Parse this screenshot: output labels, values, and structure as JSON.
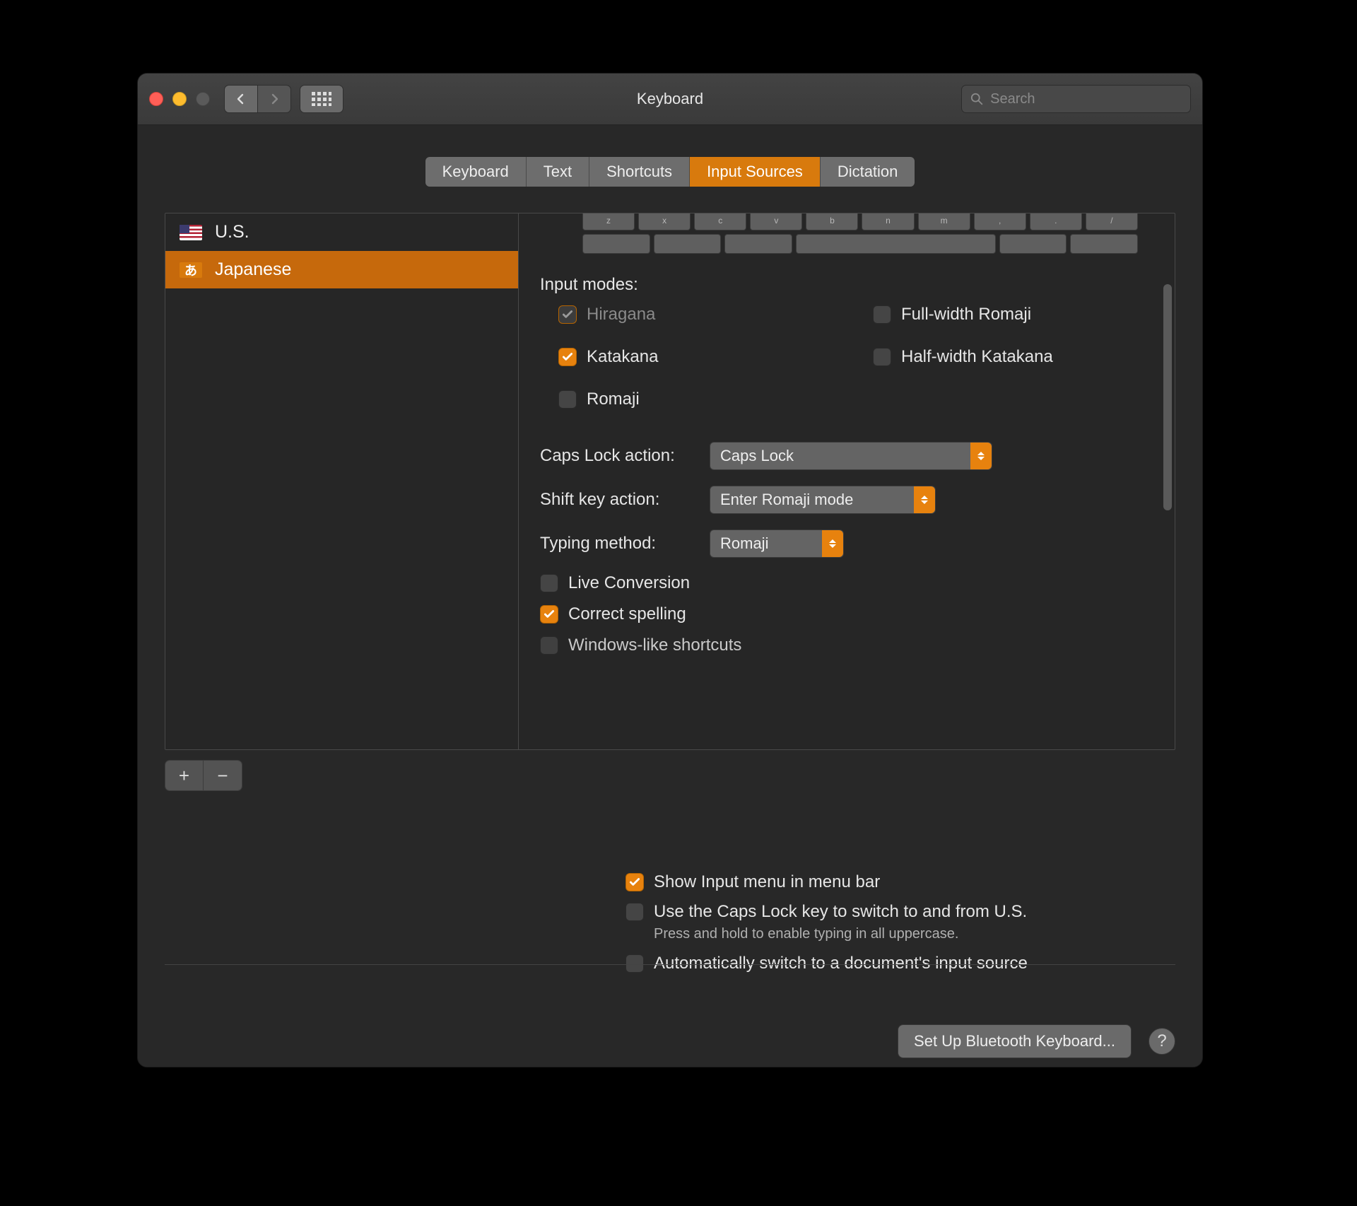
{
  "window": {
    "title": "Keyboard"
  },
  "search": {
    "placeholder": "Search"
  },
  "tabs": [
    {
      "label": "Keyboard",
      "active": false
    },
    {
      "label": "Text",
      "active": false
    },
    {
      "label": "Shortcuts",
      "active": false
    },
    {
      "label": "Input Sources",
      "active": true
    },
    {
      "label": "Dictation",
      "active": false
    }
  ],
  "sources": [
    {
      "name": "U.S.",
      "flag": "us",
      "selected": false
    },
    {
      "name": "Japanese",
      "flag": "jp",
      "glyph": "あ",
      "selected": true
    }
  ],
  "detail": {
    "input_modes_label": "Input modes:",
    "modes": {
      "hiragana": {
        "label": "Hiragana",
        "checked": true,
        "disabled": true
      },
      "katakana": {
        "label": "Katakana",
        "checked": true,
        "disabled": false
      },
      "romaji": {
        "label": "Romaji",
        "checked": false,
        "disabled": false
      },
      "full_width_romaji": {
        "label": "Full-width Romaji",
        "checked": false,
        "disabled": false
      },
      "half_width_katakana": {
        "label": "Half-width Katakana",
        "checked": false,
        "disabled": false
      }
    },
    "caps_lock_label": "Caps Lock action:",
    "caps_lock_value": "Caps Lock",
    "shift_label": "Shift key action:",
    "shift_value": "Enter Romaji mode",
    "typing_label": "Typing method:",
    "typing_value": "Romaji",
    "live_conversion": {
      "label": "Live Conversion",
      "checked": false
    },
    "correct_spelling": {
      "label": "Correct spelling",
      "checked": true
    },
    "windows_shortcuts": {
      "label": "Windows-like shortcuts",
      "checked": false
    }
  },
  "buttons": {
    "add": "+",
    "remove": "−",
    "setup_bt": "Set Up Bluetooth Keyboard...",
    "help": "?"
  },
  "global": {
    "show_menu": {
      "label": "Show Input menu in menu bar",
      "checked": true
    },
    "caps_switch": {
      "label": "Use the Caps Lock key to switch to and from U.S.",
      "checked": false
    },
    "caps_hint": "Press and hold to enable typing in all uppercase.",
    "auto_switch": {
      "label": "Automatically switch to a document's input source",
      "checked": false
    }
  },
  "colors": {
    "accent": "#e7820e"
  }
}
